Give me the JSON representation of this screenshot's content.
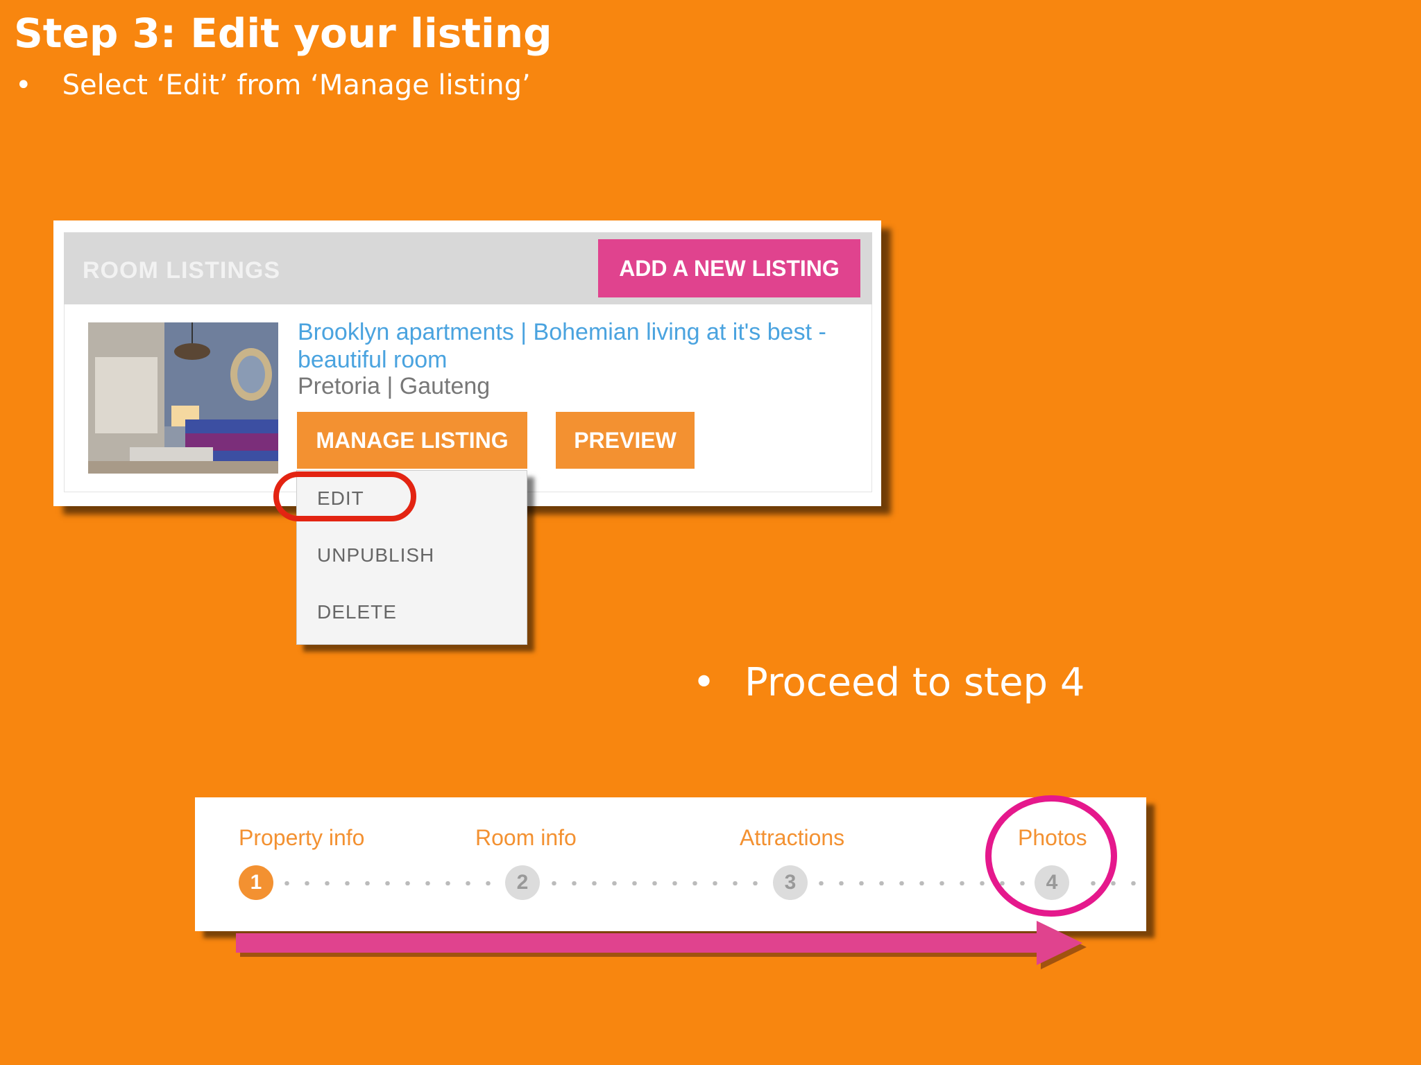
{
  "slide": {
    "title": "Step 3:  Edit your listing",
    "bullet1": "Select ‘Edit’ from ‘Manage listing’",
    "bullet2": "Proceed to step 4",
    "bullet_char": "•"
  },
  "room_listings": {
    "header_title": "ROOM LISTINGS",
    "add_button_label": "ADD A NEW LISTING",
    "listing": {
      "title": "Brooklyn apartments | Bohemian living at it's best - beautiful room",
      "location": "Pretoria | Gauteng",
      "manage_button_label": "MANAGE LISTING",
      "preview_button_label": "PREVIEW"
    },
    "dropdown": {
      "items": [
        "EDIT",
        "UNPUBLISH",
        "DELETE"
      ]
    }
  },
  "steps": {
    "items": [
      {
        "label": "Property info",
        "number": "1",
        "active": true
      },
      {
        "label": "Room info",
        "number": "2",
        "active": false
      },
      {
        "label": "Attractions",
        "number": "3",
        "active": false
      },
      {
        "label": "Photos",
        "number": "4",
        "active": false
      }
    ]
  },
  "colors": {
    "background": "#F8860F",
    "accent_pink": "#E0438E",
    "accent_orange": "#F39131",
    "link_blue": "#4AA3DF",
    "highlight_red": "#E32412",
    "highlight_magenta": "#E5188C"
  }
}
